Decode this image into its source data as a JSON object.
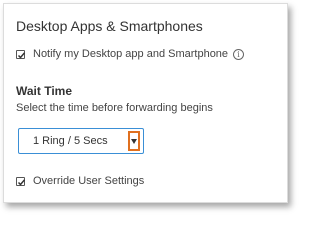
{
  "section": {
    "title": "Desktop Apps & Smartphones"
  },
  "notify": {
    "label": "Notify my Desktop app and Smartphone",
    "checked": true,
    "info_icon": "info-icon"
  },
  "wait_time": {
    "label": "Wait Time",
    "helper": "Select the time before forwarding begins",
    "selected": "1 Ring / 5 Secs",
    "arrow_icon": "caret-down-icon"
  },
  "override": {
    "label": "Override User Settings",
    "checked": true
  },
  "colors": {
    "accent": "#3a8fd6",
    "highlight": "#e0701f"
  }
}
